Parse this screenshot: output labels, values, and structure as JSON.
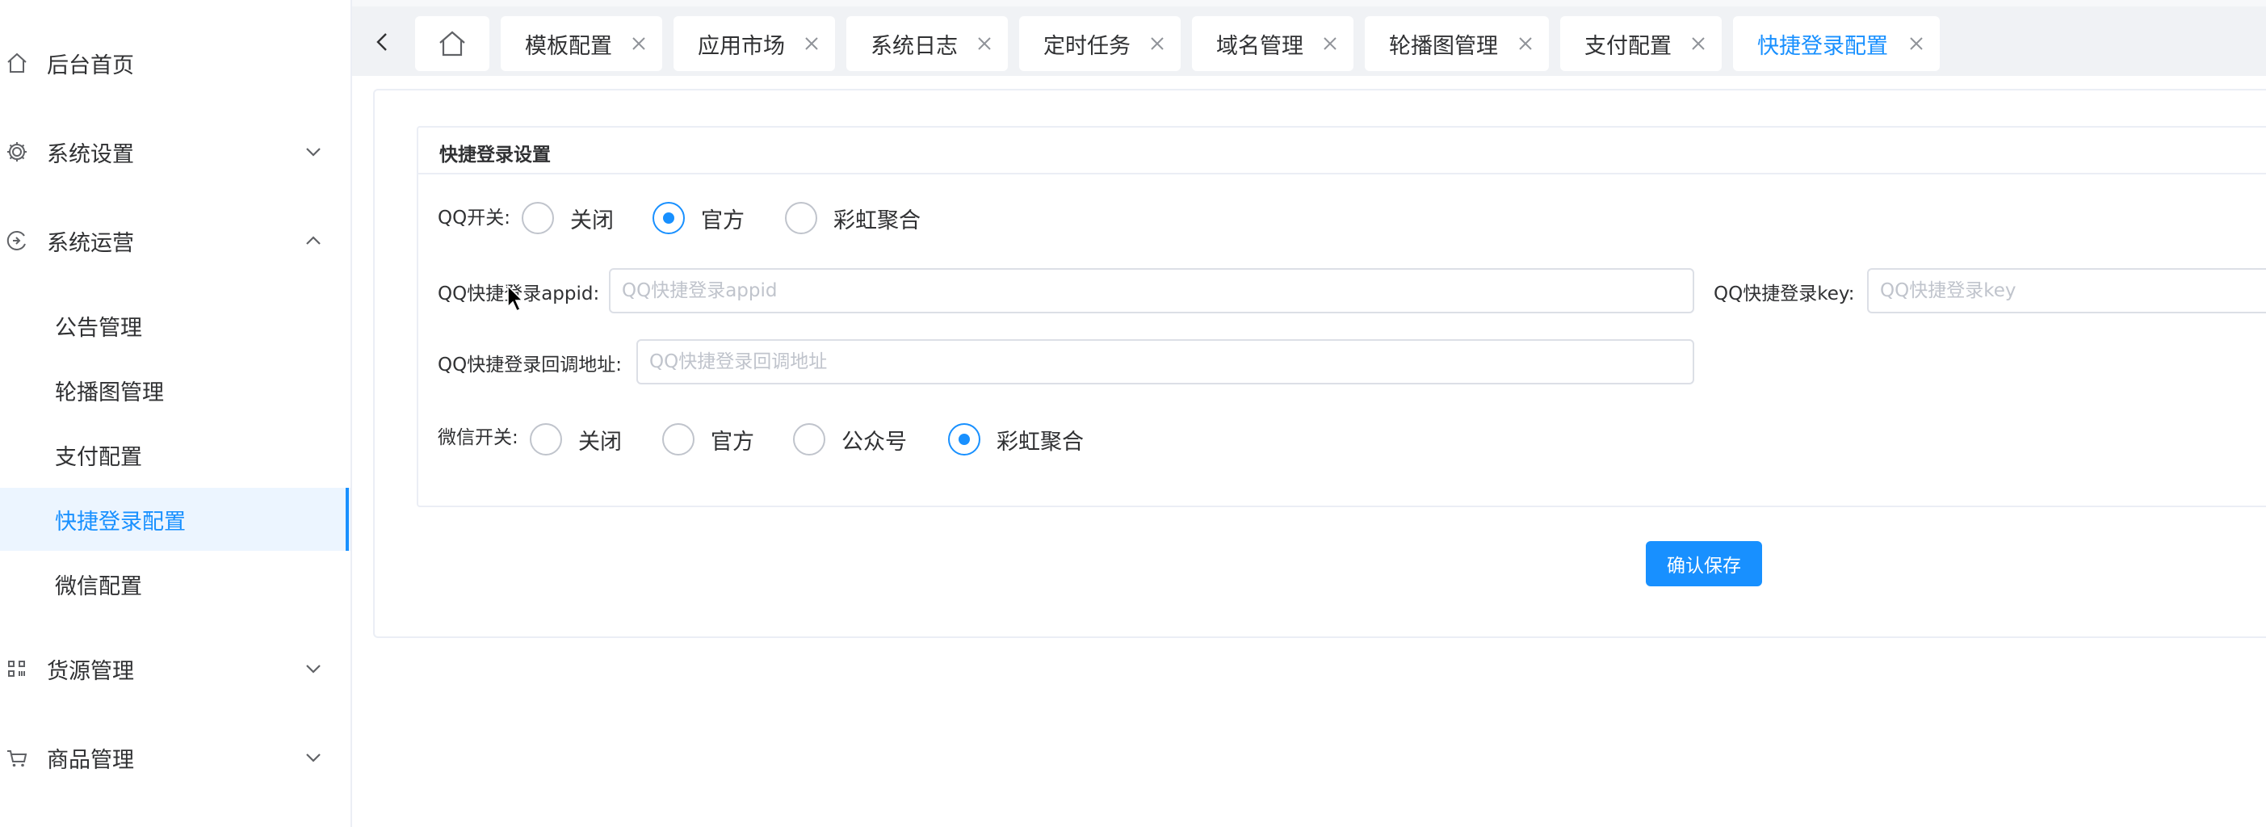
{
  "sidebar": {
    "items": [
      {
        "label": "后台首页",
        "icon": "home-icon"
      },
      {
        "label": "系统设置",
        "icon": "gear-icon",
        "expanded": false
      },
      {
        "label": "系统运营",
        "icon": "operation-icon",
        "expanded": true
      },
      {
        "label": "货源管理",
        "icon": "grid-icon",
        "expanded": false
      },
      {
        "label": "商品管理",
        "icon": "cart-icon",
        "expanded": false
      }
    ],
    "sub_items": [
      {
        "label": "公告管理"
      },
      {
        "label": "轮播图管理"
      },
      {
        "label": "支付配置"
      },
      {
        "label": "快捷登录配置",
        "active": true
      },
      {
        "label": "微信配置"
      }
    ]
  },
  "tabs": {
    "items": [
      {
        "label": "模板配置"
      },
      {
        "label": "应用市场"
      },
      {
        "label": "系统日志"
      },
      {
        "label": "定时任务"
      },
      {
        "label": "域名管理"
      },
      {
        "label": "轮播图管理"
      },
      {
        "label": "支付配置"
      },
      {
        "label": "快捷登录配置",
        "active": true
      }
    ]
  },
  "form": {
    "card_title": "快捷登录设置",
    "qq_switch": {
      "label": "QQ开关:",
      "options": [
        "关闭",
        "官方",
        "彩虹聚合"
      ],
      "selected": "官方"
    },
    "qq_appid": {
      "label": "QQ快捷登录appid:",
      "value": "",
      "placeholder": "QQ快捷登录appid"
    },
    "qq_key": {
      "label": "QQ快捷登录key:",
      "value": "",
      "placeholder": "QQ快捷登录key"
    },
    "qq_callback": {
      "label": "QQ快捷登录回调地址:",
      "value": "",
      "placeholder": "QQ快捷登录回调地址"
    },
    "wechat_switch": {
      "label": "微信开关:",
      "options": [
        "关闭",
        "官方",
        "公众号",
        "彩虹聚合"
      ],
      "selected": "彩虹聚合"
    },
    "save_label": "确认保存"
  },
  "colors": {
    "accent": "#1890ff",
    "active_bg": "#ecf5ff",
    "border": "#dcdfe6",
    "tabbar_bg": "#f0f2f5",
    "text": "#303133",
    "placeholder": "#c0c4cc"
  }
}
